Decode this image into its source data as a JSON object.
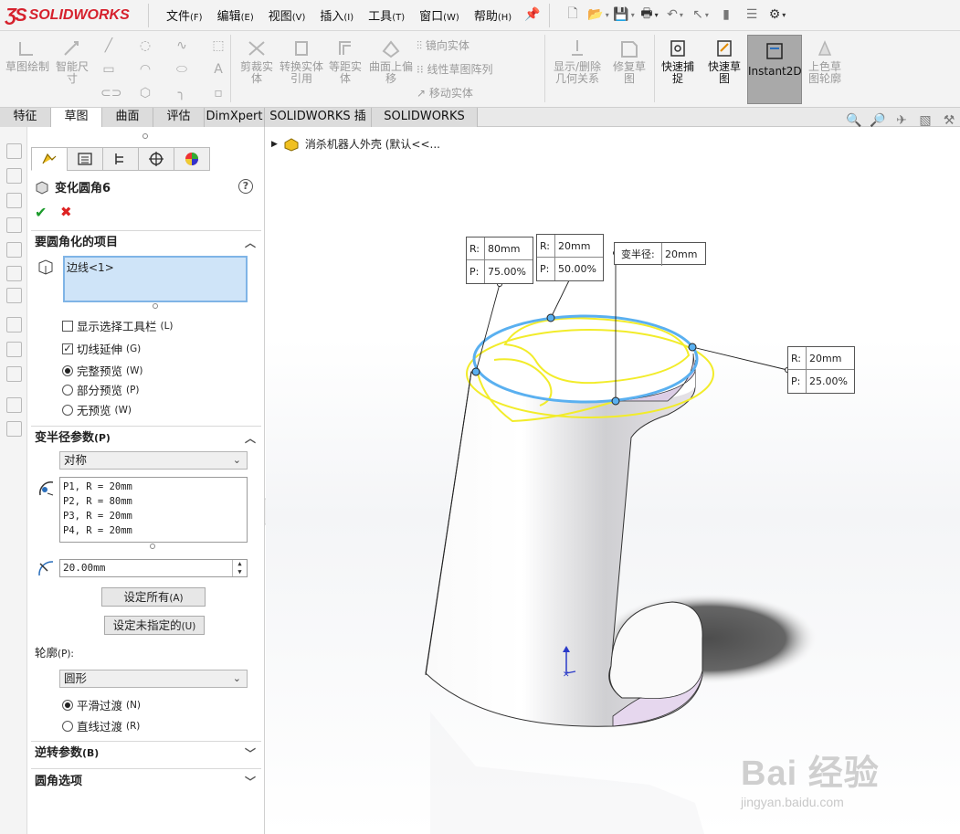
{
  "app": {
    "logo_text": "SOLIDWORKS",
    "menus": [
      {
        "label": "文件",
        "key": "(F)"
      },
      {
        "label": "编辑",
        "key": "(E)"
      },
      {
        "label": "视图",
        "key": "(V)"
      },
      {
        "label": "插入",
        "key": "(I)"
      },
      {
        "label": "工具",
        "key": "(T)"
      },
      {
        "label": "窗口",
        "key": "(W)"
      },
      {
        "label": "帮助",
        "key": "(H)"
      }
    ]
  },
  "command_manager": {
    "sketch_label": "草图绘制",
    "smart_dim_label": "智能尺寸",
    "trim_label": "剪裁实体",
    "convert_label": "转换实体引用",
    "offset_label": "等距实体",
    "surface_offset_label": "曲面上偏移",
    "mirror_label": "镜向实体",
    "linear_pattern_label": "线性草图阵列",
    "move_label": "移动实体",
    "display_relations_label": "显示/删除几何关系",
    "repair_label": "修复草图",
    "quick_snap_label": "快速捕捉",
    "rapid_sketch_label": "快速草图",
    "instant2d_label": "Instant2D",
    "shaded_sketch_label": "上色草图轮廓"
  },
  "tabs": [
    "特征",
    "草图",
    "曲面",
    "评估",
    "DimXpert",
    "SOLIDWORKS 插件",
    "SOLIDWORKS MBD"
  ],
  "active_tab": "草图",
  "property_manager": {
    "title": "变化圆角6",
    "help": "?",
    "items_section": "要圆角化的项目",
    "edge_item": "边线<1>",
    "show_toolbar_label": "显示选择工具栏",
    "show_toolbar_key": "(L)",
    "tangent_label": "切线延伸",
    "tangent_key": "(G)",
    "full_preview_label": "完整预览",
    "full_preview_key": "(W)",
    "partial_preview_label": "部分预览",
    "partial_preview_key": "(P)",
    "no_preview_label": "无预览",
    "no_preview_key": "(W)",
    "var_radius_section": "变半径参数",
    "var_radius_key": "(P)",
    "symmetric_option": "对称",
    "radius_list": [
      "P1, R = 20mm",
      "P2, R = 80mm",
      "P3, R = 20mm",
      "P4, R = 20mm"
    ],
    "radius_value": "20.00mm",
    "set_all_label": "设定所有",
    "set_all_key": "(A)",
    "set_unassigned_label": "设定未指定的",
    "set_unassigned_key": "(U)",
    "profile_label": "轮廓",
    "profile_key": "(P):",
    "profile_option": "圆形",
    "smooth_label": "平滑过渡",
    "smooth_key": "(N)",
    "straight_label": "直线过渡",
    "straight_key": "(R)",
    "reverse_section": "逆转参数",
    "reverse_key": "(B)",
    "options_section": "圆角选项"
  },
  "graphics": {
    "tree_label": "消杀机器人外壳  (默认<<...",
    "callouts": [
      {
        "r": "80mm",
        "p": "75.00%"
      },
      {
        "r": "20mm",
        "p": "50.00%"
      },
      {
        "label": "变半径:",
        "value": "20mm"
      },
      {
        "r": "20mm",
        "p": "25.00%"
      }
    ],
    "r_key": "R:",
    "p_key": "P:"
  },
  "watermark": {
    "big": "Bai 经验",
    "small": "jingyan.baidu.com"
  },
  "colors": {
    "accent": "#d6212d",
    "edge_selection": "#5ab0f0",
    "fillet_preview": "#f2ec2a"
  }
}
